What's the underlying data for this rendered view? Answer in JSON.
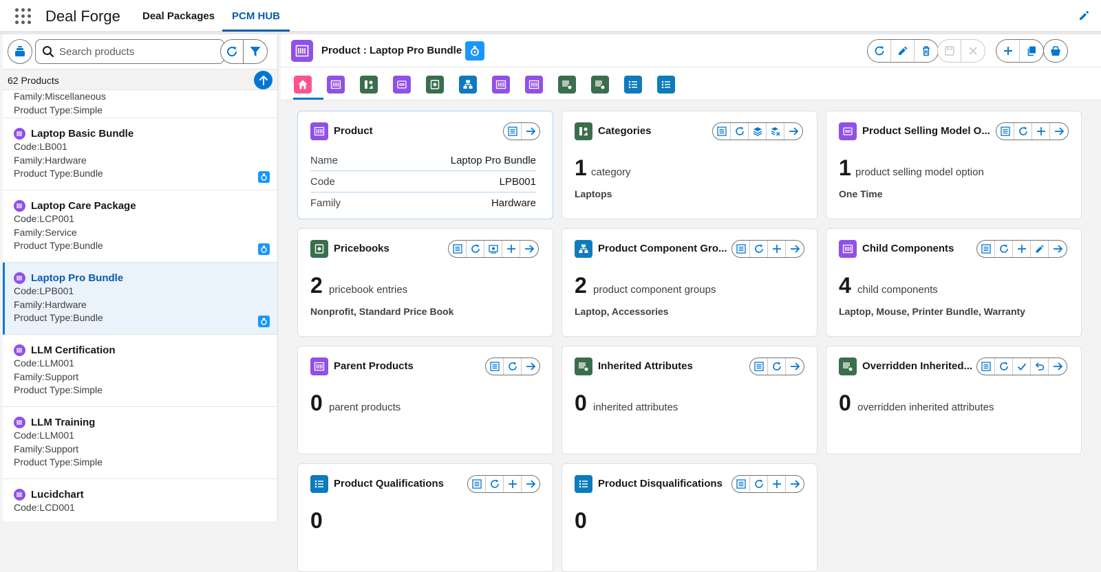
{
  "app": {
    "name": "Deal Forge",
    "tabs": [
      "Deal Packages",
      "PCM HUB"
    ],
    "active_tab": "PCM HUB"
  },
  "left": {
    "search_placeholder": "Search products",
    "count_label": "62 Products",
    "items": [
      {
        "name": "",
        "code": "",
        "family": "Family:Miscellaneous",
        "type": "Product Type:Simple"
      },
      {
        "name": "Laptop Basic Bundle",
        "code": "Code:LB001",
        "family": "Family:Hardware",
        "type": "Product Type:Bundle"
      },
      {
        "name": "Laptop Care Package",
        "code": "Code:LCP001",
        "family": "Family:Service",
        "type": "Product Type:Bundle"
      },
      {
        "name": "Laptop Pro Bundle",
        "code": "Code:LPB001",
        "family": "Family:Hardware",
        "type": "Product Type:Bundle"
      },
      {
        "name": "LLM Certification",
        "code": "Code:LLM001",
        "family": "Family:Support",
        "type": "Product Type:Simple"
      },
      {
        "name": "LLM Training",
        "code": "Code:LLM001",
        "family": "Family:Support",
        "type": "Product Type:Simple"
      },
      {
        "name": "Lucidchart",
        "code": "Code:LCD001",
        "family": "",
        "type": ""
      }
    ]
  },
  "header": {
    "title": "Product : Laptop Pro Bundle"
  },
  "cards": {
    "product": {
      "title": "Product",
      "rows": [
        {
          "label": "Name",
          "value": "Laptop Pro Bundle"
        },
        {
          "label": "Code",
          "value": "LPB001"
        },
        {
          "label": "Family",
          "value": "Hardware"
        }
      ]
    },
    "categories": {
      "title": "Categories",
      "count": "1",
      "unit": "category",
      "sub": "Laptops"
    },
    "psmo": {
      "title": "Product Selling Model O...",
      "count": "1",
      "unit": "product selling model option",
      "sub": "One Time"
    },
    "pricebooks": {
      "title": "Pricebooks",
      "count": "2",
      "unit": "pricebook entries",
      "sub": "Nonprofit, Standard Price Book"
    },
    "pcg": {
      "title": "Product Component Gro...",
      "count": "2",
      "unit": "product component groups",
      "sub": "Laptop, Accessories"
    },
    "child": {
      "title": "Child Components",
      "count": "4",
      "unit": "child components",
      "sub": "Laptop, Mouse, Printer Bundle, Warranty"
    },
    "parent": {
      "title": "Parent Products",
      "count": "0",
      "unit": "parent products",
      "sub": ""
    },
    "inherited": {
      "title": "Inherited Attributes",
      "count": "0",
      "unit": "inherited attributes",
      "sub": ""
    },
    "overridden": {
      "title": "Overridden Inherited...",
      "count": "0",
      "unit": "overridden inherited attributes",
      "sub": ""
    },
    "qual": {
      "title": "Product Qualifications",
      "count": "0"
    },
    "disqual": {
      "title": "Product Disqualifications",
      "count": "0"
    }
  },
  "colors": {
    "purple": "#9050e9",
    "green": "#3b6e4c",
    "teal": "#0b827c",
    "blue": "#0176d3",
    "pink": "#ff538a",
    "cyan": "#0d7bbd"
  }
}
